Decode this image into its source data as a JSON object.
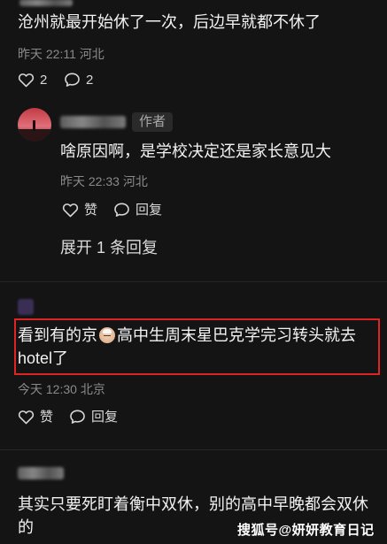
{
  "comment1": {
    "text": "沧州就最开始休了一次，后边早就都不休了",
    "time_location": "昨天 22:11 河北",
    "likes": "2",
    "replies": "2"
  },
  "reply1": {
    "author_badge": "作者",
    "text": "啥原因啊，是学校决定还是家长意见大",
    "time_location": "昨天 22:33 河北",
    "like_label": "赞",
    "reply_label": "回复",
    "expand_label": "展开 1 条回复"
  },
  "comment2": {
    "text_before": "看到有的京",
    "text_after": "高中生周末星巴克学完习转头就去hotel了",
    "time_location": "今天 12:30 北京",
    "like_label": "赞",
    "reply_label": "回复"
  },
  "comment3": {
    "text": "其实只要死盯着衡中双休，别的高中早晚都会双休的"
  },
  "watermark": "搜狐号@妍妍教育日记"
}
